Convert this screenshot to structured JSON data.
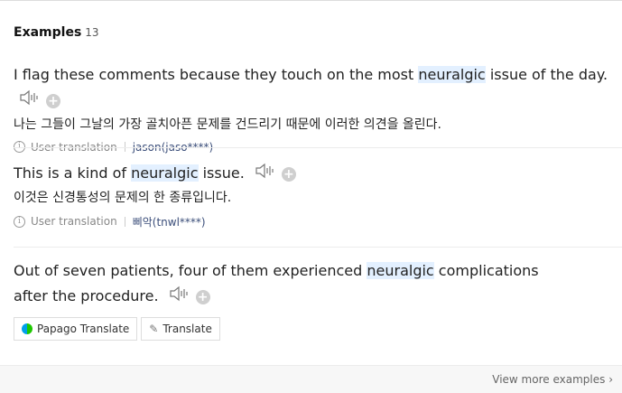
{
  "header": {
    "title": "Examples",
    "count": "13"
  },
  "examples": [
    {
      "sentence_before": "I flag these comments because they touch on the most ",
      "highlight": "neuralgic",
      "sentence_after": " issue of the day.",
      "translation": "나는 그들이 그날의 가장 골치아픈 문제를 건드리기 때문에 이러한 의견을 올린다.",
      "source_label": "User translation",
      "user": "jason(jaso****)"
    },
    {
      "sentence_before": "This is a kind of ",
      "highlight": "neuralgic",
      "sentence_after": " issue.",
      "translation": "이것은 신경통성의 문제의 한 종류입니다.",
      "source_label": "User translation",
      "user": "삐악(tnwl****)"
    },
    {
      "sentence_before": "Out of seven patients, four of them experienced ",
      "highlight": "neuralgic",
      "sentence_after": " complications after the procedure.",
      "buttons": {
        "papago": "Papago Translate",
        "translate": "Translate"
      }
    }
  ],
  "footer": {
    "more": "View more examples"
  },
  "colors": {
    "highlight": "#e3f0ff",
    "user_link": "#3b4e7a"
  },
  "icons": [
    "speaker-icon",
    "plus-icon",
    "info-icon",
    "papago-logo-icon",
    "pencil-icon",
    "chevron-right-icon"
  ]
}
